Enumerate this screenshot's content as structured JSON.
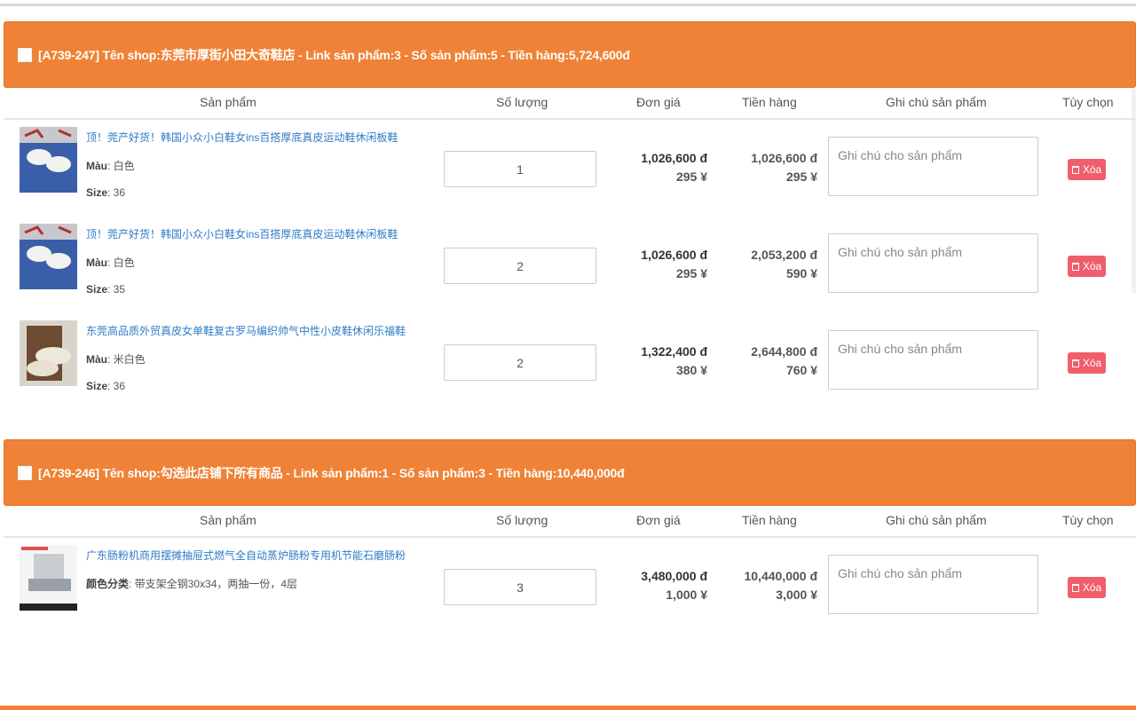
{
  "columns": {
    "product": "Sản phẩm",
    "quantity": "Số lượng",
    "unit_price": "Đơn giá",
    "amount": "Tiền hàng",
    "note": "Ghi chú sản phẩm",
    "options": "Tùy chọn"
  },
  "note_placeholder": "Ghi chú cho sản phẩm",
  "delete_label": "Xóa",
  "colors": {
    "accent": "#ef8236",
    "link": "#2f7cc6",
    "delete": "#f05e6b"
  },
  "shops": [
    {
      "title": "[A739-247] Tên shop:东莞市厚街小田大奇鞋店 - Link sản phẩm:3 - Số sản phẩm:5 - Tiền hàng:5,724,600đ",
      "items": [
        {
          "name": "顶！莞产好货！韩国小众小白鞋女ins百搭厚底真皮运动鞋休闲板鞋",
          "attrs": [
            {
              "key": "Màu",
              "value": ": 白色"
            },
            {
              "key": "Size",
              "value": ": 36"
            }
          ],
          "quantity": "1",
          "unit_vnd": "1,026,600 đ",
          "unit_cny": "295 ¥",
          "total_vnd": "1,026,600 đ",
          "total_cny": "295 ¥"
        },
        {
          "name": "顶！莞产好货！韩国小众小白鞋女ins百搭厚底真皮运动鞋休闲板鞋",
          "attrs": [
            {
              "key": "Màu",
              "value": ": 白色"
            },
            {
              "key": "Size",
              "value": ": 35"
            }
          ],
          "quantity": "2",
          "unit_vnd": "1,026,600 đ",
          "unit_cny": "295 ¥",
          "total_vnd": "2,053,200 đ",
          "total_cny": "590 ¥"
        },
        {
          "name": "东莞高品质外贸真皮女单鞋复古罗马编织帅气中性小皮鞋休闲乐福鞋",
          "attrs": [
            {
              "key": "Màu",
              "value": ": 米白色"
            },
            {
              "key": "Size",
              "value": ": 36"
            }
          ],
          "quantity": "2",
          "unit_vnd": "1,322,400 đ",
          "unit_cny": "380 ¥",
          "total_vnd": "2,644,800 đ",
          "total_cny": "760 ¥"
        }
      ]
    },
    {
      "title": "[A739-246] Tên shop:勾选此店铺下所有商品 - Link sản phẩm:1 - Số sản phẩm:3 - Tiền hàng:10,440,000đ",
      "items": [
        {
          "name": "广东肠粉机商用摆摊抽屉式燃气全自动蒸炉肠粉专用机节能石磨肠粉",
          "attrs": [
            {
              "key": "颜色分类",
              "value": ": 带支架全钢30x34，两抽一份，4层"
            }
          ],
          "quantity": "3",
          "unit_vnd": "3,480,000 đ",
          "unit_cny": "1,000 ¥",
          "total_vnd": "10,440,000 đ",
          "total_cny": "3,000 ¥"
        }
      ]
    }
  ]
}
